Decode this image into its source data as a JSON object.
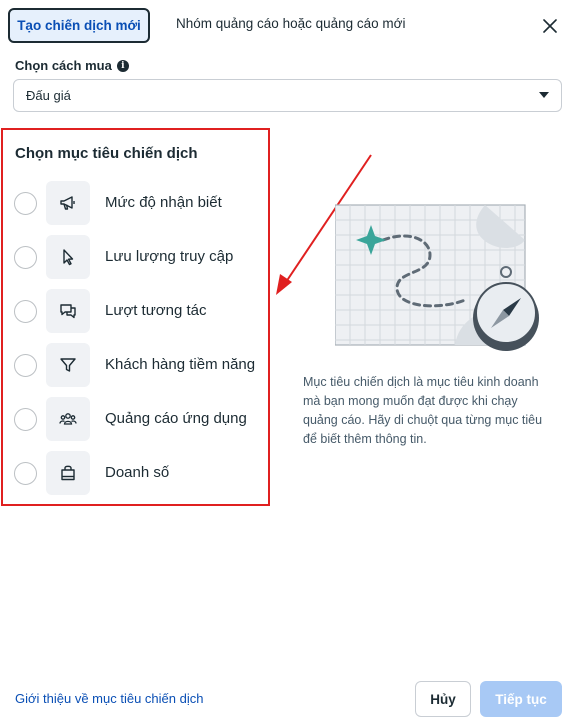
{
  "header": {
    "tab_active": "Tạo chiến dịch mới",
    "tab_inactive": "Nhóm quảng cáo hoặc quảng cáo mới",
    "close_icon": "close-icon"
  },
  "buying_type": {
    "label": "Chọn cách mua",
    "info_glyph": "i",
    "selected": "Đấu giá"
  },
  "objectives": {
    "title": "Chọn mục tiêu chiến dịch",
    "items": [
      {
        "label": "Mức độ nhận biết",
        "icon": "megaphone-icon"
      },
      {
        "label": "Lưu lượng truy cập",
        "icon": "cursor-icon"
      },
      {
        "label": "Lượt tương tác",
        "icon": "chat-bubbles-icon"
      },
      {
        "label": "Khách hàng tiềm năng",
        "icon": "funnel-icon"
      },
      {
        "label": "Quảng cáo ứng dụng",
        "icon": "people-group-icon"
      },
      {
        "label": "Doanh số",
        "icon": "shopping-bag-icon"
      }
    ]
  },
  "description": "Mục tiêu chiến dịch là mục tiêu kinh doanh mà bạn mong muốn đạt được khi chạy quảng cáo. Hãy di chuột qua từng mục tiêu để biết thêm thông tin.",
  "footer": {
    "link": "Giới thiệu về mục tiêu chiến dịch",
    "cancel": "Hủy",
    "next": "Tiếp tục"
  },
  "colors": {
    "accent": "#0a4fb5",
    "highlight_border": "#e02020",
    "disabled_button": "#a8c9f5"
  }
}
